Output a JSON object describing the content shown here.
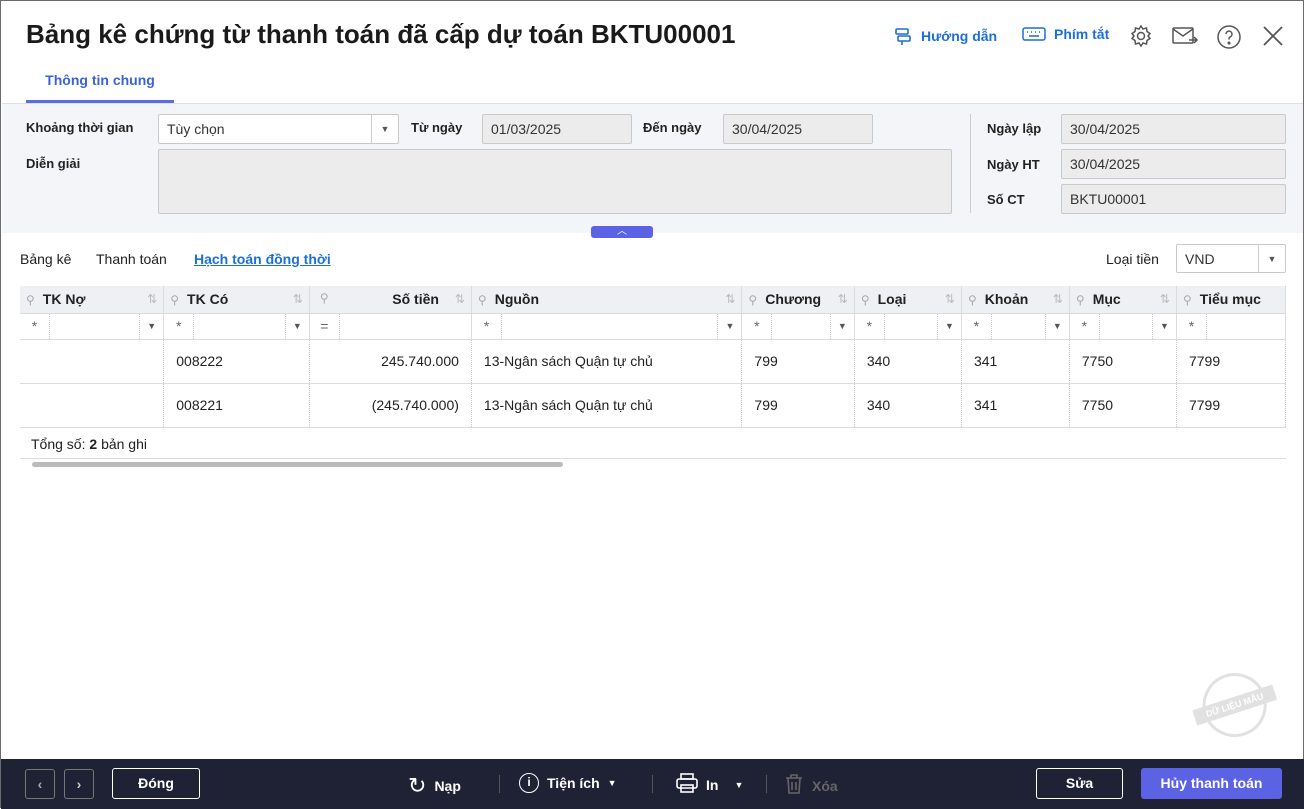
{
  "title": "Bảng kê chứng từ thanh toán đã cấp dự toán BKTU00001",
  "header": {
    "guide": "Hướng dẫn",
    "shortcuts": "Phím tắt"
  },
  "tabs": [
    "Thông tin chung"
  ],
  "form": {
    "period_label": "Khoảng thời gian",
    "period_value": "Tùy chọn",
    "from_label": "Từ ngày",
    "from_value": "01/03/2025",
    "to_label": "Đến ngày",
    "to_value": "30/04/2025",
    "desc_label": "Diễn giải",
    "desc_value": "",
    "created_label": "Ngày lập",
    "created_value": "30/04/2025",
    "posted_label": "Ngày HT",
    "posted_value": "30/04/2025",
    "docno_label": "Số CT",
    "docno_value": "BKTU00001"
  },
  "subtabs": [
    "Bảng kê",
    "Thanh toán",
    "Hạch toán đồng thời"
  ],
  "currency": {
    "label": "Loại tiền",
    "value": "VND"
  },
  "grid": {
    "columns": [
      {
        "label": "TK Nợ",
        "op": "*"
      },
      {
        "label": "TK Có",
        "op": "*"
      },
      {
        "label": "Số tiền",
        "op": "="
      },
      {
        "label": "Nguồn",
        "op": "*"
      },
      {
        "label": "Chương",
        "op": "*"
      },
      {
        "label": "Loại",
        "op": "*"
      },
      {
        "label": "Khoản",
        "op": "*"
      },
      {
        "label": "Mục",
        "op": "*"
      },
      {
        "label": "Tiểu mục",
        "op": "*"
      }
    ],
    "rows": [
      [
        "",
        "008222",
        "245.740.000",
        "13-Ngân sách Quận tự chủ",
        "799",
        "340",
        "341",
        "7750",
        "7799"
      ],
      [
        "",
        "008221",
        "(245.740.000)",
        "13-Ngân sách Quận tự chủ",
        "799",
        "340",
        "341",
        "7750",
        "7799"
      ]
    ],
    "total_prefix": "Tổng số:",
    "total_count": "2",
    "total_suffix": "bản ghi"
  },
  "watermark": "DỮ LIỆU MẪU",
  "toolbar": {
    "close": "Đóng",
    "reload": "Nạp",
    "utilities": "Tiện ích",
    "print": "In",
    "delete": "Xóa",
    "edit": "Sửa",
    "cancel_payment": "Hủy thanh toán"
  }
}
